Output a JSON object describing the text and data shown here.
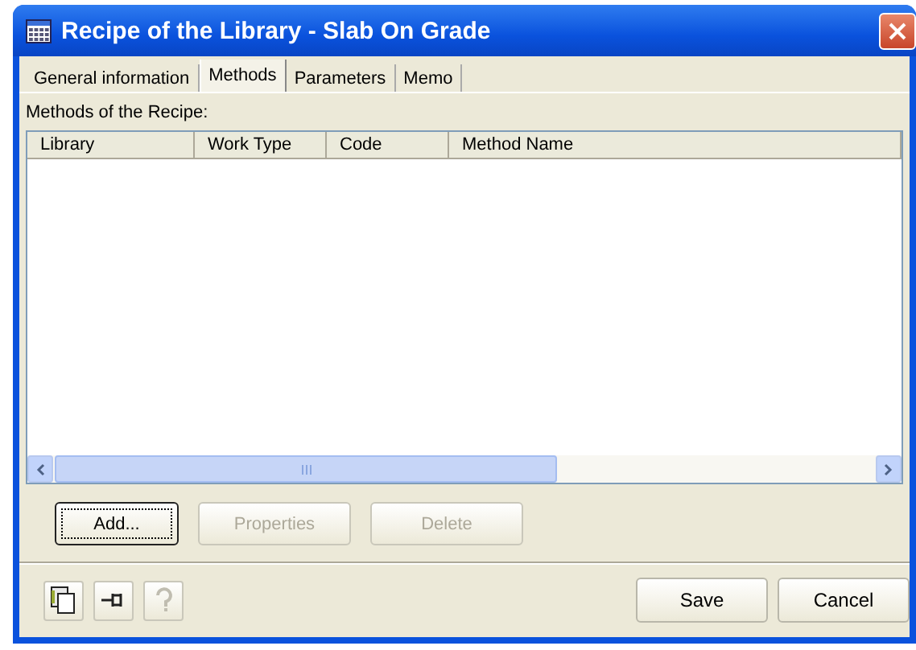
{
  "window": {
    "title": "Recipe of the Library - Slab On Grade"
  },
  "tabs": [
    {
      "label": "General information",
      "selected": false
    },
    {
      "label": "Methods",
      "selected": true
    },
    {
      "label": "Parameters",
      "selected": false
    },
    {
      "label": "Memo",
      "selected": false
    }
  ],
  "section_label": "Methods of the Recipe:",
  "table": {
    "columns": [
      "Library",
      "Work Type",
      "Code",
      "Method Name"
    ]
  },
  "list_buttons": [
    {
      "label": "Add...",
      "disabled": false,
      "focused": true
    },
    {
      "label": "Properties",
      "disabled": true,
      "focused": false
    },
    {
      "label": "Delete",
      "disabled": true,
      "focused": false
    }
  ],
  "tool_buttons": [
    {
      "kind": "pages",
      "disabled": false
    },
    {
      "kind": "pin",
      "disabled": false
    },
    {
      "kind": "help",
      "disabled": true
    }
  ],
  "dialog_buttons": [
    "Save",
    "Cancel"
  ]
}
